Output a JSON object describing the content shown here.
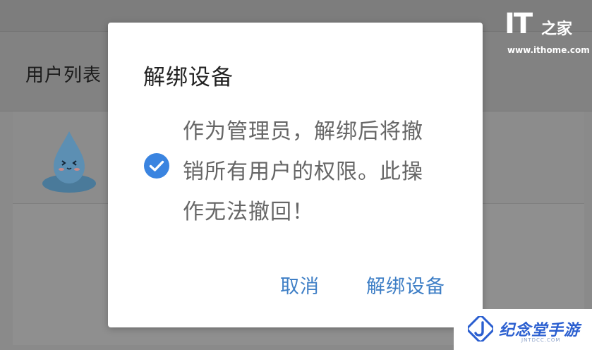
{
  "background": {
    "list_title": "用户列表"
  },
  "watermark": {
    "logo_it": "IT",
    "logo_zhi": "之家",
    "url": "www.ithome.com"
  },
  "dialog": {
    "title": "解绑设备",
    "message": "作为管理员，解绑后将撤销所有用户的权限。此操作无法撤回！",
    "icon": "check-circle-icon",
    "cancel_label": "取消",
    "confirm_label": "解绑设备"
  },
  "brand": {
    "name": "纪念堂手游",
    "sub": "JNTDCC.COM"
  },
  "colors": {
    "accent": "#3f7fc6",
    "check": "#3a84e0",
    "overlay": "#8a8a8a"
  }
}
